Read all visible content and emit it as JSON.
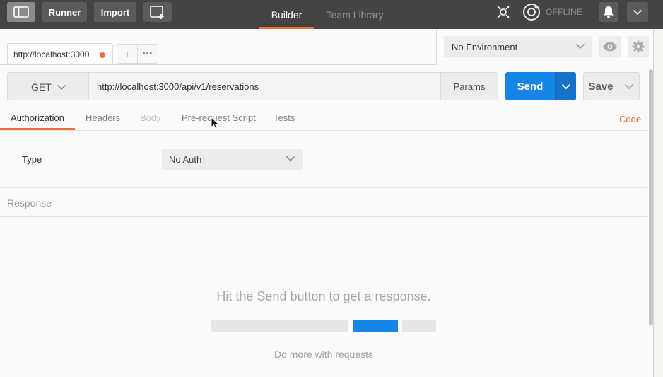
{
  "topbar": {
    "runner_label": "Runner",
    "import_label": "Import",
    "nav_tabs": [
      "Builder",
      "Team Library"
    ],
    "status_text": "OFFLINE",
    "icons": [
      "sidebar-toggle-icon",
      "new-window-icon",
      "interceptor-icon",
      "sync-icon",
      "bell-icon",
      "chevron-down-icon"
    ]
  },
  "tabs": {
    "request_tab_label": "http://localhost:3000",
    "add_label": "+",
    "more_label": "•••"
  },
  "environment": {
    "selected": "No Environment"
  },
  "request": {
    "method": "GET",
    "url": "http://localhost:3000/api/v1/reservations",
    "params_label": "Params",
    "send_label": "Send",
    "save_label": "Save"
  },
  "subtabs": {
    "items": [
      "Authorization",
      "Headers",
      "Body",
      "Pre-request Script",
      "Tests"
    ],
    "active": "Authorization",
    "code_link": "Code"
  },
  "auth": {
    "type_label": "Type",
    "type_value": "No Auth"
  },
  "response": {
    "label": "Response",
    "hint": "Hit the Send button to get a response.",
    "more": "Do more with requests"
  },
  "colors": {
    "accent": "#f26b3a",
    "primary": "#1785e5",
    "topbar": "#444444"
  }
}
